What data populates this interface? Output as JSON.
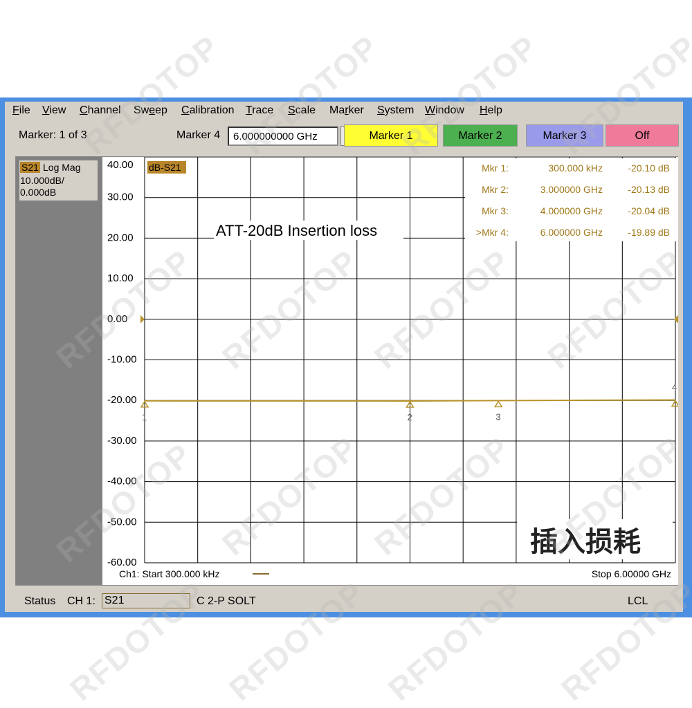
{
  "menu": [
    {
      "label": "File",
      "ul": 0
    },
    {
      "label": "View",
      "ul": 0
    },
    {
      "label": "Channel",
      "ul": 0
    },
    {
      "label": "Sweep",
      "ul": 2
    },
    {
      "label": "Calibration",
      "ul": 0
    },
    {
      "label": "Trace",
      "ul": 0
    },
    {
      "label": "Scale",
      "ul": 0
    },
    {
      "label": "Marker",
      "ul": 2
    },
    {
      "label": "System",
      "ul": 0
    },
    {
      "label": "Window",
      "ul": 0
    },
    {
      "label": "Help",
      "ul": 0
    }
  ],
  "toolbar": {
    "marker_count": "Marker: 1 of 3",
    "marker_label": "Marker 4",
    "marker_freq": "6.000000000 GHz",
    "buttons": [
      {
        "label": "Marker 1",
        "color": "#ffff33"
      },
      {
        "label": "Marker 2",
        "color": "#4caf50"
      },
      {
        "label": "Marker 3",
        "color": "#9a9aea"
      },
      {
        "label": "Off",
        "color": "#f07a9a"
      }
    ]
  },
  "trace_box": {
    "param": "S21",
    "format": "Log Mag",
    "scale": "10.000dB/",
    "ref": "0.000dB"
  },
  "trace_label": "dB-S21",
  "annotation": "ATT-20dB Insertion loss",
  "chinese_label": "插入损耗",
  "markers_table": [
    {
      "name": "Mkr  1:",
      "freq": "300.000 kHz",
      "value": "-20.10 dB"
    },
    {
      "name": "Mkr  2:",
      "freq": "3.000000 GHz",
      "value": "-20.13 dB"
    },
    {
      "name": "Mkr  3:",
      "freq": "4.000000 GHz",
      "value": "-20.04 dB"
    },
    {
      "name": ">Mkr  4:",
      "freq": "6.000000 GHz",
      "value": "-19.89 dB"
    }
  ],
  "footer": {
    "start": "Ch1: Start  300.000 kHz",
    "stop": "Stop  6.00000 GHz"
  },
  "status": {
    "label": "Status",
    "channel": "CH 1:",
    "param": "S21",
    "cal": "C  2-P SOLT",
    "lcl": "LCL"
  },
  "watermark": "RFDOTOP",
  "chart_data": {
    "type": "line",
    "ylim": [
      -60,
      40
    ],
    "yticks": [
      "40.00",
      "30.00",
      "20.00",
      "10.00",
      "0.00",
      "-10.00",
      "-20.00",
      "-30.00",
      "-40.00",
      "-50.00",
      "-60.00"
    ],
    "xlim_ghz": [
      0.0003,
      6.0
    ],
    "series": [
      {
        "name": "dB-S21",
        "x_ghz": [
          0.0003,
          1,
          2,
          3,
          4,
          5,
          6
        ],
        "y_db": [
          -20.1,
          -20.12,
          -20.11,
          -20.13,
          -20.04,
          -19.95,
          -19.89
        ]
      }
    ],
    "markers": [
      {
        "id": "1",
        "x_ghz": 0.0003
      },
      {
        "id": "2",
        "x_ghz": 3.0
      },
      {
        "id": "3",
        "x_ghz": 4.0
      },
      {
        "id": "4",
        "x_ghz": 6.0
      }
    ],
    "colors": {
      "trace": "#b8942a",
      "marker_text": "#a07818",
      "grid": "#000000"
    }
  }
}
